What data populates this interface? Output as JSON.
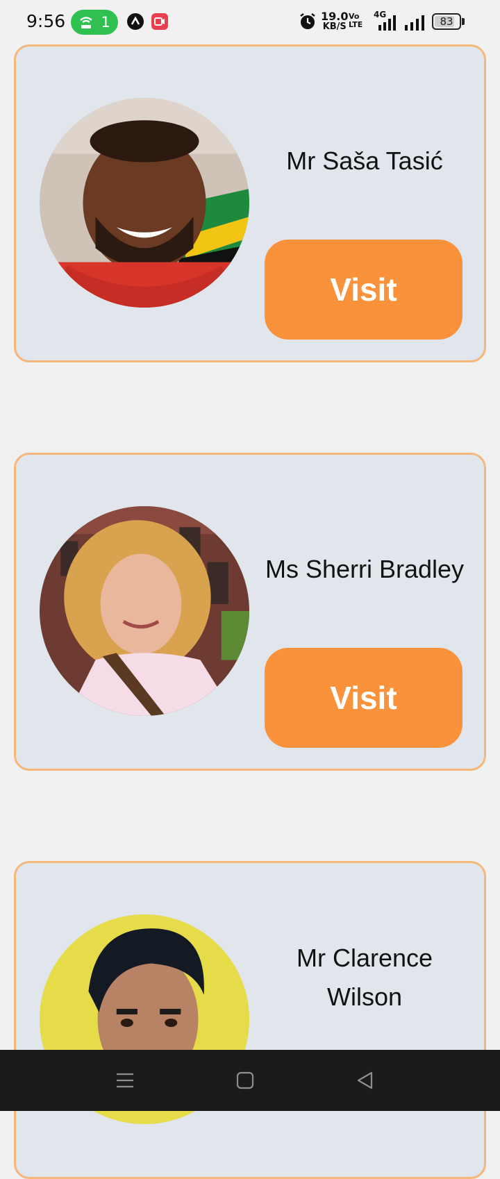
{
  "status_bar": {
    "time": "9:56",
    "hotspot_count": "1",
    "net_speed_value": "19.0",
    "net_speed_unit": "KB/S",
    "volte_top": "Vo",
    "volte_bottom": "LTE",
    "network_type": "4G",
    "battery_level": "83",
    "battery_fraction": 0.83,
    "hotspot_color": "#2fc04f",
    "icons": [
      "hotspot-icon",
      "nav-app-icon",
      "screen-record-icon",
      "alarm-icon",
      "signal-icon",
      "battery-icon"
    ]
  },
  "cards": [
    {
      "name": "Mr Saša Tasić",
      "button_label": "Visit"
    },
    {
      "name": "Ms Sherri Bradley",
      "button_label": "Visit"
    },
    {
      "name": "Mr Clarence Wilson",
      "button_label": ""
    }
  ],
  "colors": {
    "card_background": "#e1e6ec",
    "card_border": "#f5b77a",
    "button_background": "#f9923a",
    "page_background": "#f1f1f1"
  },
  "navigation": {
    "icons": [
      "menu-icon",
      "home-icon",
      "back-icon"
    ]
  }
}
